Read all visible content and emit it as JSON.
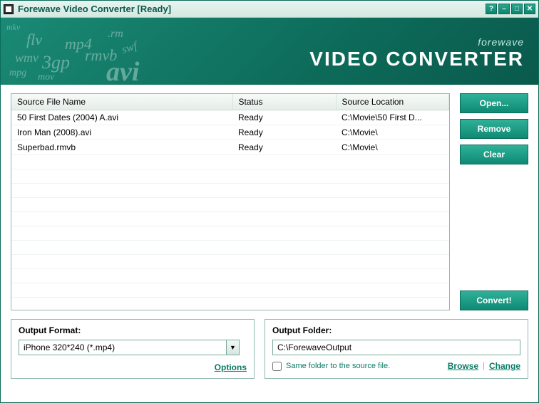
{
  "window": {
    "title": "Forewave Video Converter [Ready]"
  },
  "branding": {
    "small": "forewave",
    "large": "VIDEO CONVERTER"
  },
  "grid": {
    "headers": {
      "name": "Source File Name",
      "status": "Status",
      "location": "Source Location"
    },
    "rows": [
      {
        "name": "50 First Dates (2004) A.avi",
        "status": "Ready",
        "location": "C:\\Movie\\50 First D..."
      },
      {
        "name": "Iron Man (2008).avi",
        "status": "Ready",
        "location": "C:\\Movie\\"
      },
      {
        "name": "Superbad.rmvb",
        "status": "Ready",
        "location": "C:\\Movie\\"
      }
    ]
  },
  "buttons": {
    "open": "Open...",
    "remove": "Remove",
    "clear": "Clear",
    "convert": "Convert!"
  },
  "outputFormat": {
    "title": "Output Format:",
    "selected": "iPhone 320*240 (*.mp4)",
    "optionsLink": "Options"
  },
  "outputFolder": {
    "title": "Output Folder:",
    "path": "C:\\ForewaveOutput",
    "sameFolderLabel": "Same folder to the source file.",
    "browse": "Browse",
    "change": "Change"
  },
  "decor": [
    "flv",
    "mp4",
    ".rm",
    "wmv",
    "3gp",
    "rmvb",
    "swf",
    "avi",
    "mpg",
    "mov",
    "mkv"
  ]
}
